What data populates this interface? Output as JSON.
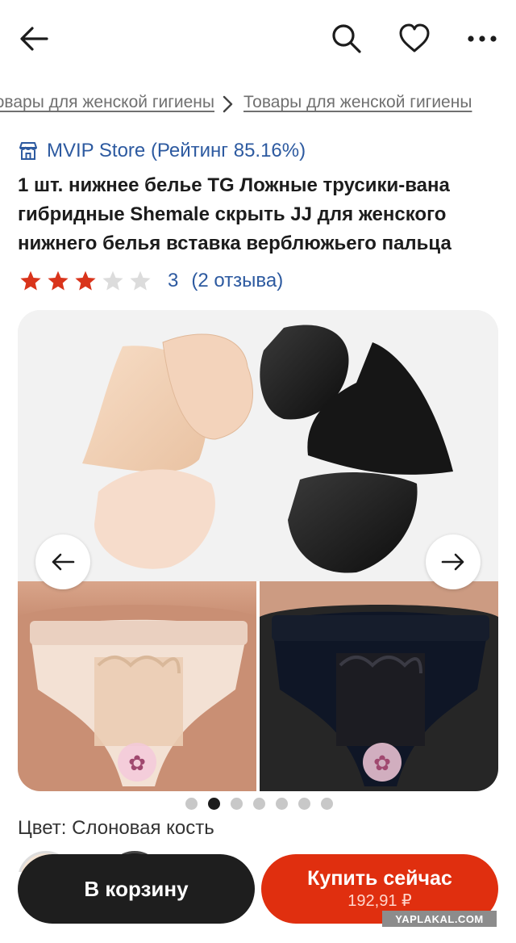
{
  "icons": {
    "back": "arrow-left-icon",
    "search": "search-icon",
    "favorite": "heart-icon",
    "more": "more-icon",
    "store": "shop-icon",
    "prev": "arrow-left-icon",
    "next": "arrow-right-icon"
  },
  "breadcrumb": {
    "items": [
      {
        "label": "Товары для женской гигиены"
      },
      {
        "label": "Товары для женской гигиены"
      }
    ],
    "separator": ">"
  },
  "store": {
    "label": "MVIP Store (Рейтинг 85.16%)"
  },
  "product": {
    "title": "1 шт. нижнее белье TG Ложные трусики-вана гибридные Shemale скрыть JJ для женского нижнего белья вставка верблюжьего пальца",
    "rating_value": 3,
    "rating_max": 5,
    "rating_text": "3",
    "reviews_text": "(2 отзыва)"
  },
  "gallery": {
    "image_count": 7,
    "active_index": 1
  },
  "color": {
    "label": "Цвет: Слоновая кость"
  },
  "actions": {
    "cart_label": "В корзину",
    "buy_label": "Купить сейчас",
    "buy_price": "192,91 ₽"
  },
  "watermark": "YAPLAKAL.COM",
  "colors": {
    "accent": "#e02f0f",
    "link": "#2d5aa0",
    "star": "#d9341b",
    "dark": "#1e1e1e"
  }
}
